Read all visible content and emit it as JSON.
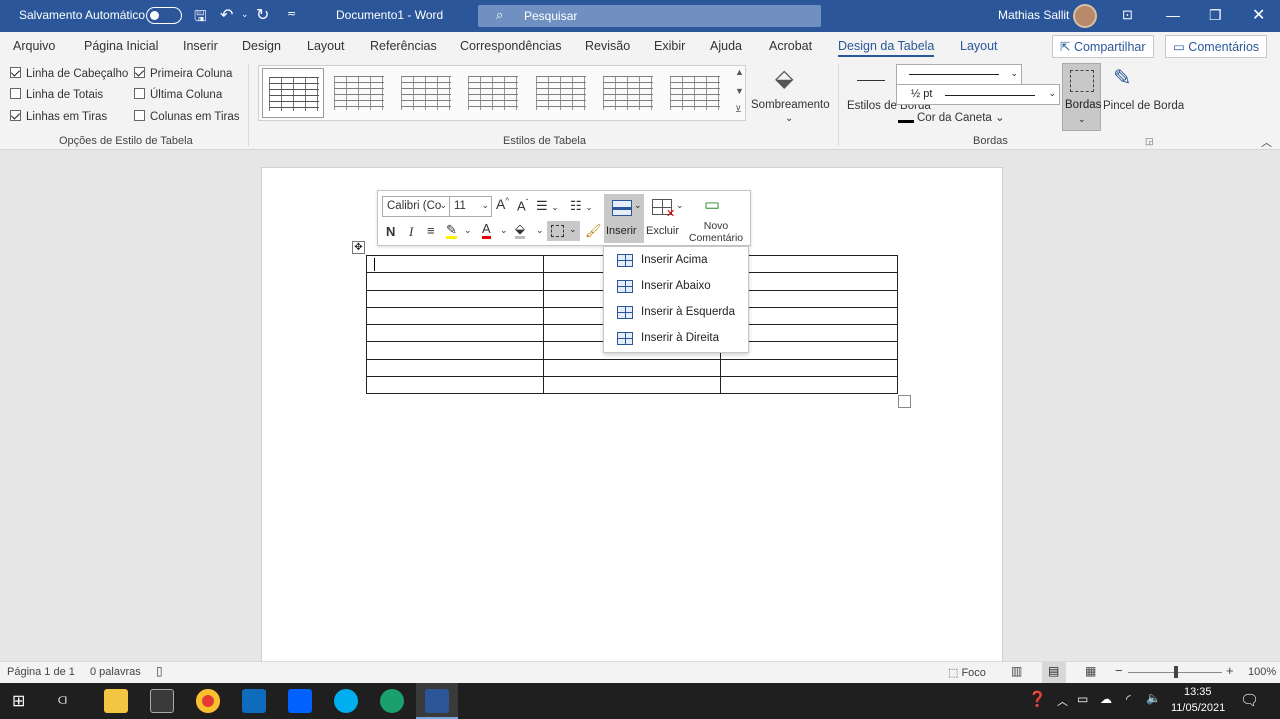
{
  "titlebar": {
    "autosave_label": "Salvamento Automático",
    "doc_title": "Documento1  -  Word",
    "search_placeholder": "Pesquisar",
    "user_name": "Mathias Sallit"
  },
  "tabs": [
    "Arquivo",
    "Página Inicial",
    "Inserir",
    "Design",
    "Layout",
    "Referências",
    "Correspondências",
    "Revisão",
    "Exibir",
    "Ajuda",
    "Acrobat",
    "Design da Tabela",
    "Layout"
  ],
  "tab_buttons": {
    "share": "Compartilhar",
    "comments": "Comentários"
  },
  "ribbon": {
    "options": {
      "header_row": "Linha de Cabeçalho",
      "first_column": "Primeira Coluna",
      "total_row": "Linha de Totais",
      "last_column": "Última Coluna",
      "banded_rows": "Linhas em Tiras",
      "banded_columns": "Colunas em Tiras",
      "group_label": "Opções de Estilo de Tabela"
    },
    "table_styles_label": "Estilos de Tabela",
    "shading_label": "Sombreamento",
    "border_styles_label": "Estilos de Borda",
    "pen_weight": "½ pt",
    "pen_color_label": "Cor da Caneta",
    "borders_label": "Bordas",
    "border_painter_label": "Pincel de Borda",
    "borders_group_label": "Bordas"
  },
  "mini_toolbar": {
    "font_name": "Calibri (Co",
    "font_size": "11",
    "insert_label": "Inserir",
    "delete_label": "Excluir",
    "new_comment_label": "Novo Comentário",
    "bold": "N",
    "italic": "I"
  },
  "insert_menu": [
    "Inserir Acima",
    "Inserir Abaixo",
    "Inserir à Esquerda",
    "Inserir à Direita"
  ],
  "status": {
    "page": "Página 1 de 1",
    "words": "0 palavras",
    "focus": "Foco",
    "zoom": "100%"
  },
  "taskbar": {
    "time": "13:35",
    "date": "11/05/2021"
  }
}
